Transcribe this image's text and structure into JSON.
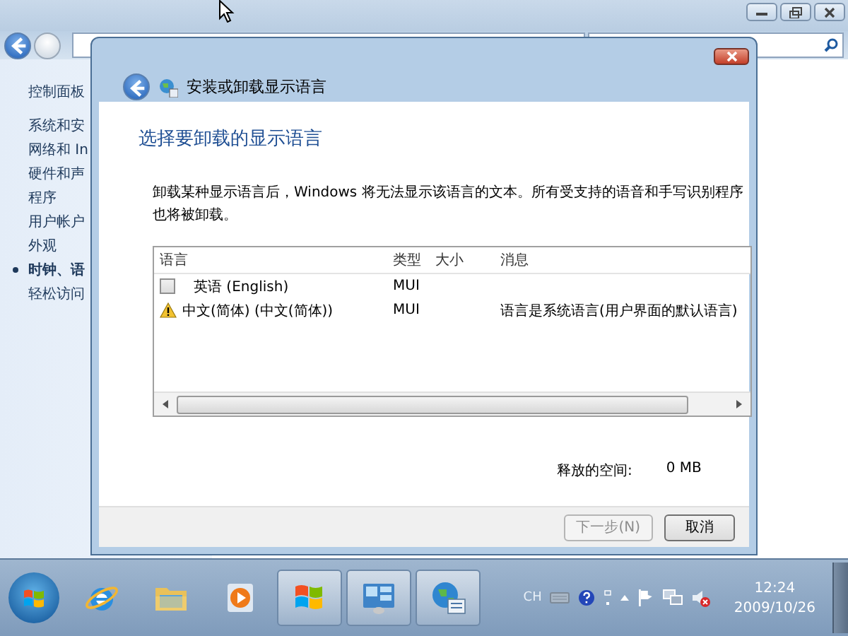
{
  "explorer": {
    "sidebar": {
      "items": [
        {
          "label": "控制面板",
          "selected": false
        },
        {
          "label": "系统和安",
          "selected": false
        },
        {
          "label": "网络和 In",
          "selected": false
        },
        {
          "label": "硬件和声",
          "selected": false
        },
        {
          "label": "程序",
          "selected": false
        },
        {
          "label": "用户帐户",
          "selected": false
        },
        {
          "label": "外观",
          "selected": false
        },
        {
          "label": "时钟、语",
          "selected": true
        },
        {
          "label": "轻松访问",
          "selected": false
        }
      ]
    }
  },
  "dialog": {
    "title": "安装或卸载显示语言",
    "heading": "选择要卸载的显示语言",
    "description": "卸载某种显示语言后，Windows 将无法显示该语言的文本。所有受支持的语音和手写识别程序也将被卸载。",
    "table": {
      "columns": [
        "语言",
        "类型",
        "大小",
        "消息"
      ],
      "rows": [
        {
          "kind": "checkbox",
          "checked": false,
          "language": "英语 (English)",
          "type": "MUI"
        },
        {
          "kind": "warning",
          "language": "中文(简体) (中文(简体))",
          "type": "MUI",
          "message": "语言是系统语言(用户界面的默认语言)"
        }
      ]
    },
    "freed_space": {
      "label": "释放的空间:",
      "value": "0 MB"
    },
    "buttons": [
      {
        "label": "下一步(N)",
        "disabled": true
      },
      {
        "label": "取消",
        "disabled": false
      }
    ]
  },
  "taskbar": {
    "apps": [
      {
        "kind": "ie",
        "active": false
      },
      {
        "kind": "folder",
        "active": false
      },
      {
        "kind": "media",
        "active": false
      },
      {
        "kind": "flag",
        "active": true
      },
      {
        "kind": "panel",
        "active": true
      },
      {
        "kind": "globe",
        "active": true
      }
    ],
    "language": "CH",
    "time": "12:24",
    "date": "2009/10/26"
  }
}
